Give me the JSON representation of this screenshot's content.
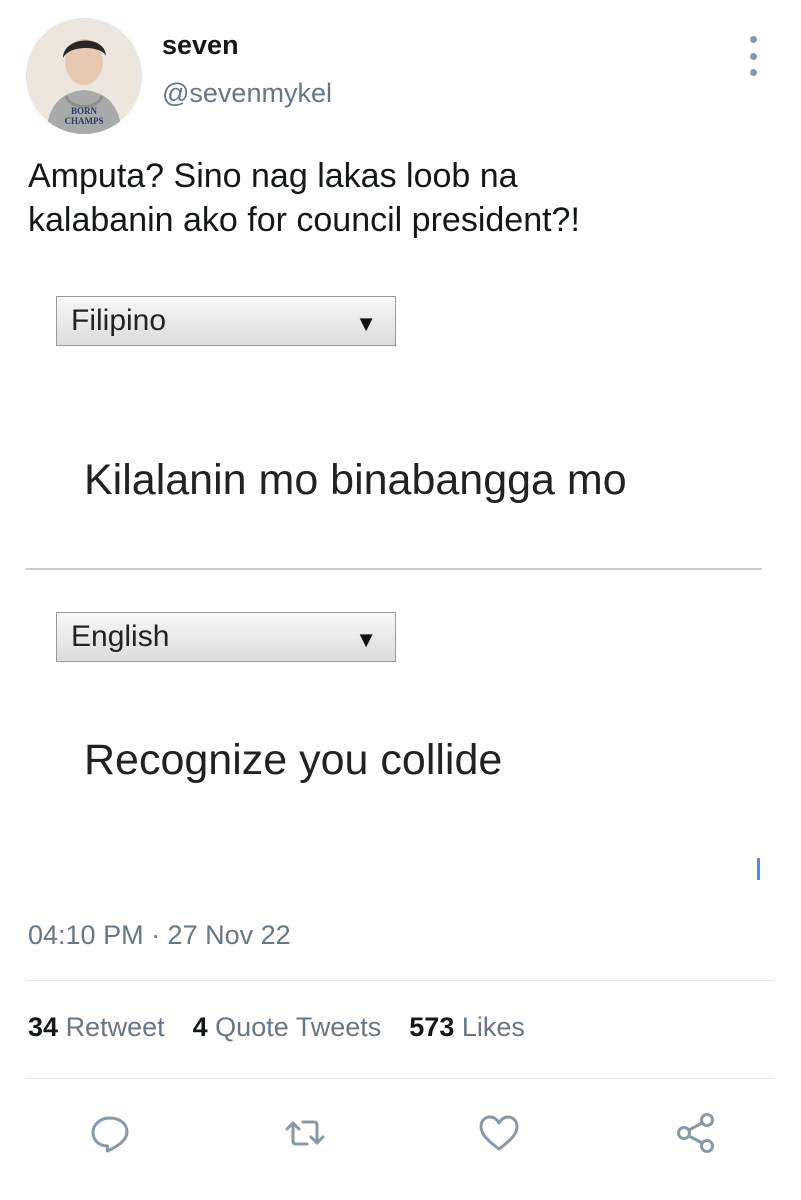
{
  "tweet": {
    "display_name": "seven",
    "handle": "@sevenmykel",
    "avatar_icon": "user-avatar",
    "avatar_shirt_text": [
      "BORN",
      "CHAMPS"
    ],
    "text_lines": [
      "Amputa? Sino nag lakas loob na",
      "kalabanin ako for council president?!"
    ],
    "timestamp": "04:10 PM · 27 Nov 22",
    "stats": {
      "retweets_count": "34",
      "retweets_label": "Retweet",
      "quotes_count": "4",
      "quotes_label": "Quote Tweets",
      "likes_count": "573",
      "likes_label": "Likes"
    }
  },
  "translation_image": {
    "source_language": "Filipino",
    "source_text": "Kilalanin mo binabangga mo",
    "target_language": "English",
    "target_text": "Recognize you collide",
    "dropdown_glyph": "▼"
  },
  "actions": [
    "reply-icon",
    "retweet-icon",
    "like-icon",
    "share-icon"
  ],
  "colors": {
    "text_primary": "#14171a",
    "text_secondary": "#657786",
    "icon": "#8899a6",
    "divider": "#e1e8ed"
  }
}
